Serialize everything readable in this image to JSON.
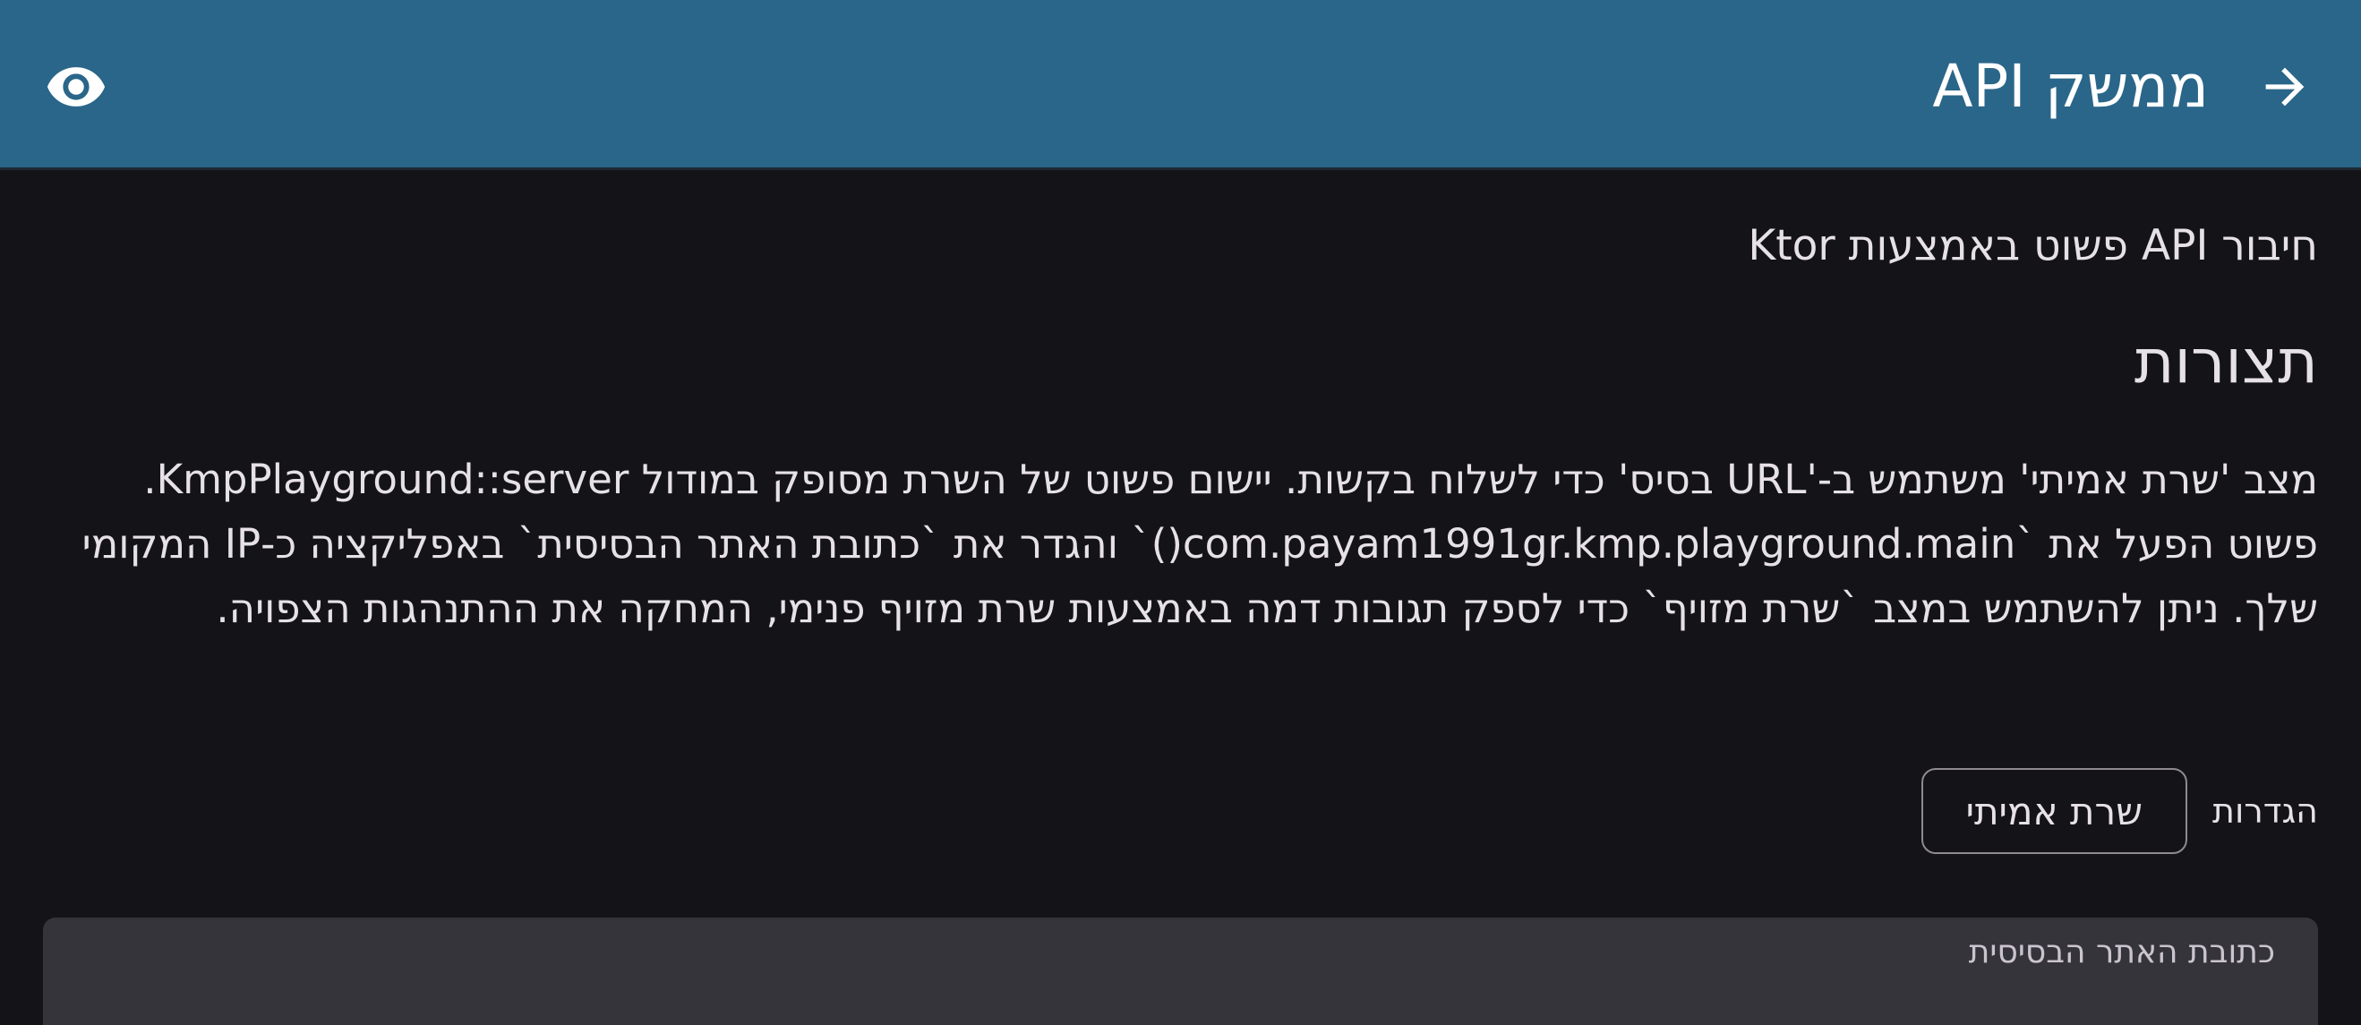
{
  "app_bar": {
    "title": "ממשק API",
    "back_icon": "arrow-forward-icon",
    "visibility_icon": "eye-icon"
  },
  "main": {
    "subtitle": "חיבור API פשוט באמצעות Ktor",
    "section_title": "תצורות",
    "description": "מצב 'שרת אמיתי' משתמש ב-'URL בסיס' כדי לשלוח בקשות. יישום פשוט של השרת מסופק במודול KmpPlayground::server. פשוט הפעל את `com.payam1991gr.kmp.playground.main()` והגדר את `כתובת האתר הבסיסית` באפליקציה כ-IP המקומי שלך. ניתן להשתמש במצב `שרת מזויף` כדי לספק תגובות דמה באמצעות שרת מזויף פנימי, המחקה את ההתנהגות הצפויה.",
    "settings_label": "הגדרות",
    "mode_button_label": "שרת אמיתי",
    "base_url_label": "כתובת האתר הבסיסית"
  },
  "colors": {
    "app_bar_bg": "#2A6689",
    "background": "#141318",
    "text": "#E6E1E6",
    "field_bg": "#36343B",
    "outline": "#8F8A91"
  }
}
